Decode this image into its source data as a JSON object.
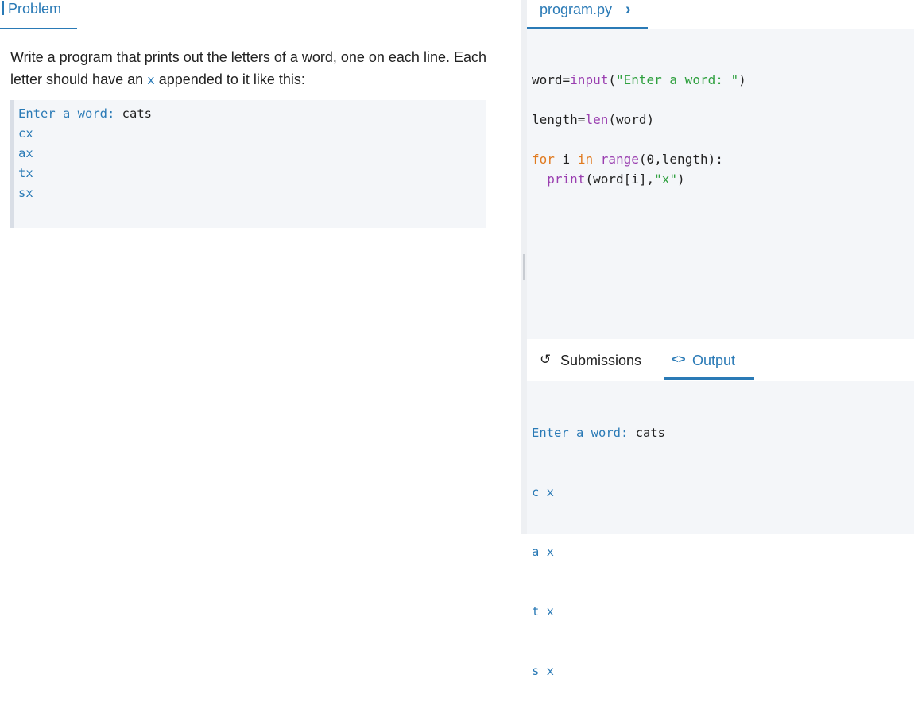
{
  "problem": {
    "tab_label": "Problem",
    "description_before": "Write a program that prints out the letters of a word, one on each line. Each letter should have an ",
    "description_code": "x",
    "description_after": " appended to it like this:",
    "example": {
      "prompt": "Enter a word: ",
      "input": "cats",
      "lines": [
        "cx",
        "ax",
        "tx",
        "sx"
      ]
    }
  },
  "editor": {
    "file_tab": "program.py",
    "chevron": "›",
    "code": {
      "l1": {
        "a": "word=",
        "b": "input",
        "c": "(",
        "d": "\"Enter a word: \"",
        "e": ")"
      },
      "l2": {
        "a": "length=",
        "b": "len",
        "c": "(word)"
      },
      "l3": {
        "a": "for",
        "b": " i ",
        "c": "in",
        "d": " ",
        "e": "range",
        "f": "(0,length):"
      },
      "l4": {
        "a": "  ",
        "b": "print",
        "c": "(word[i],",
        "d": "\"x\"",
        "e": ")"
      }
    }
  },
  "bottom": {
    "tabs": {
      "submissions": {
        "icon": "↺",
        "label": "Submissions"
      },
      "output": {
        "icon": "<>",
        "label": "Output"
      }
    }
  },
  "output": {
    "prompt": "Enter a word: ",
    "input": "cats",
    "lines": [
      "c x",
      "a x",
      "t x",
      "s x"
    ]
  },
  "colors": {
    "accent": "#2a7ab6",
    "keyword": "#e07a1f",
    "builtin": "#9a3fb0",
    "string": "#2fa03f",
    "panel_bg": "#f4f6f9"
  }
}
